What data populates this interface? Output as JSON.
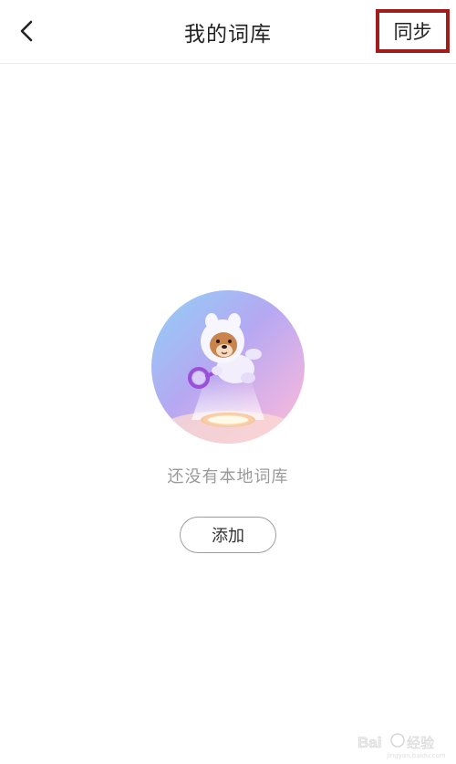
{
  "header": {
    "title": "我的词库",
    "sync_label": "同步",
    "back_icon": "chevron-left-icon"
  },
  "empty_state": {
    "message": "还没有本地词库",
    "add_label": "添加",
    "illustration": "astronaut-dog-with-magnifier"
  },
  "watermark": {
    "text": "Bai经验",
    "subtext": "jingyan.baidu.com"
  },
  "colors": {
    "highlight_border": "#a21c1c",
    "title_text": "#222222",
    "hint_text": "#9a9a9a",
    "button_border": "#9d9d9d"
  }
}
